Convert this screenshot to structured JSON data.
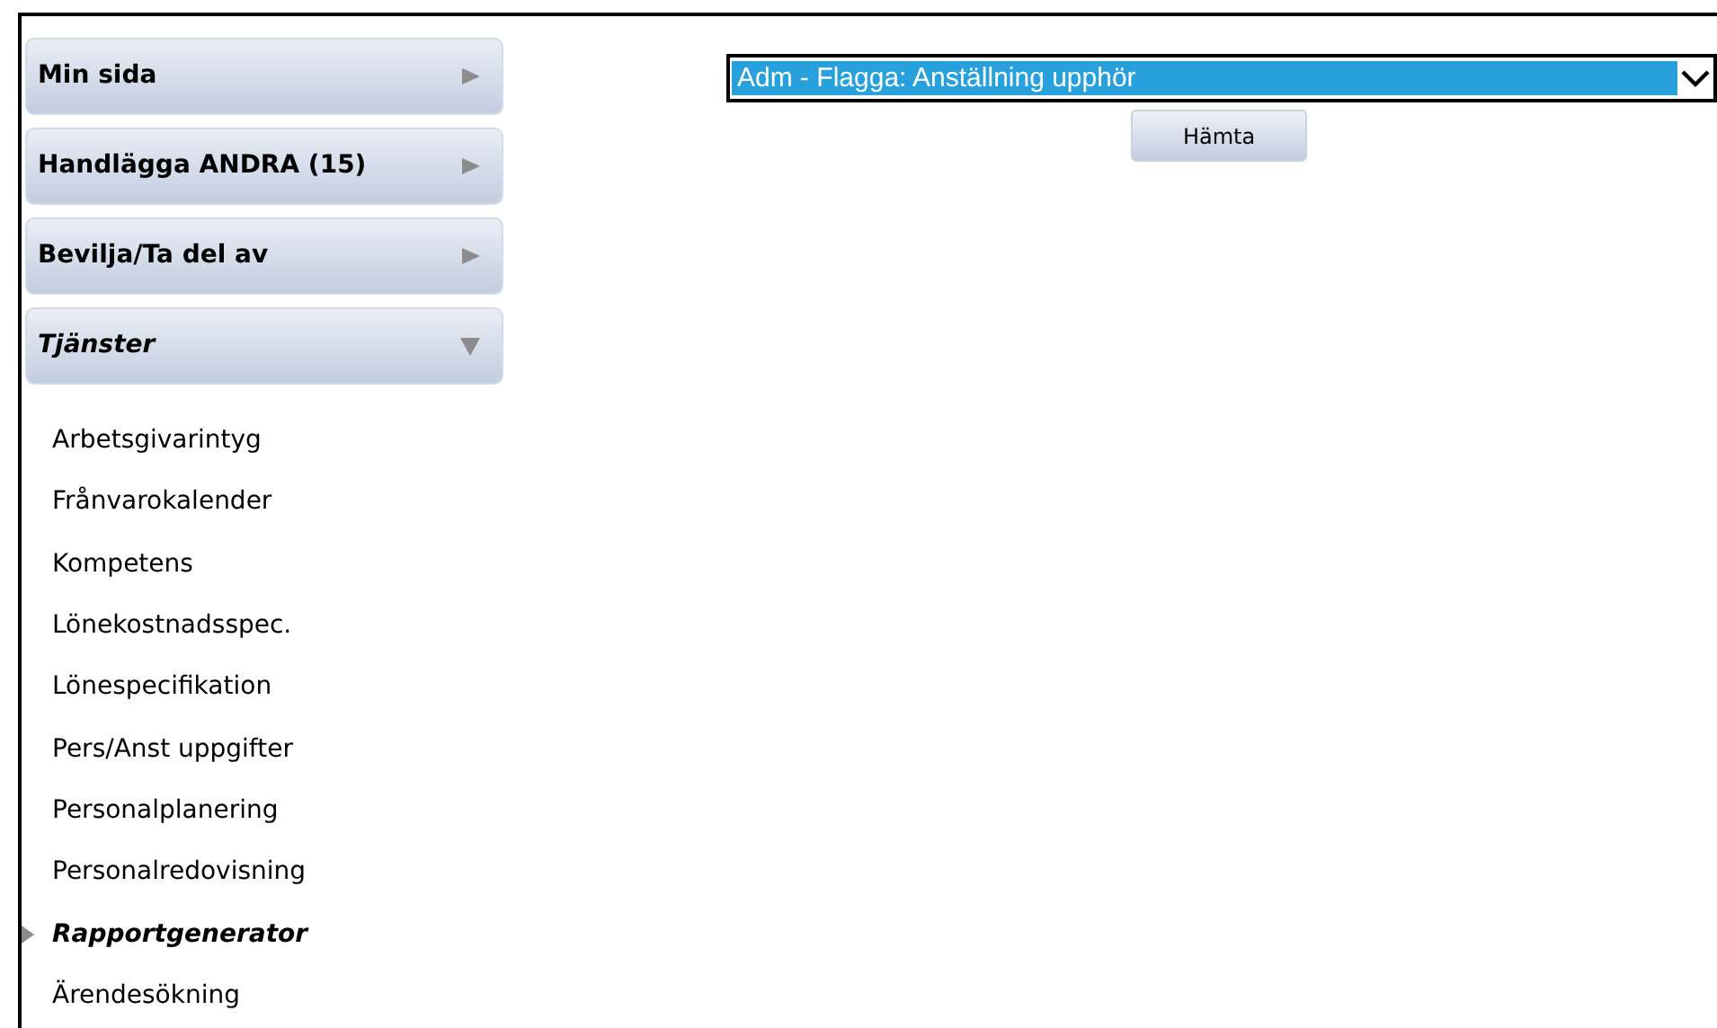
{
  "menu": [
    {
      "label": "Min sida",
      "expanded": false
    },
    {
      "label": "Handlägga ANDRA (15)",
      "expanded": false
    },
    {
      "label": "Bevilja/Ta del av",
      "expanded": false
    },
    {
      "label": "Tjänster",
      "expanded": true,
      "children": [
        {
          "label": "Arbetsgivarintyg",
          "selected": false
        },
        {
          "label": "Frånvarokalender",
          "selected": false
        },
        {
          "label": "Kompetens",
          "selected": false
        },
        {
          "label": "Lönekostnadsspec.",
          "selected": false
        },
        {
          "label": "Lönespecifikation",
          "selected": false
        },
        {
          "label": "Pers/Anst uppgifter",
          "selected": false
        },
        {
          "label": "Personalplanering",
          "selected": false
        },
        {
          "label": "Personalredovisning",
          "selected": false
        },
        {
          "label": "Rapportgenerator",
          "selected": true
        },
        {
          "label": "Ärendesökning",
          "selected": false
        }
      ]
    }
  ],
  "report_select": {
    "value": "Adm - Flagga: Anställning upphör"
  },
  "fetch_button": "Hämta"
}
